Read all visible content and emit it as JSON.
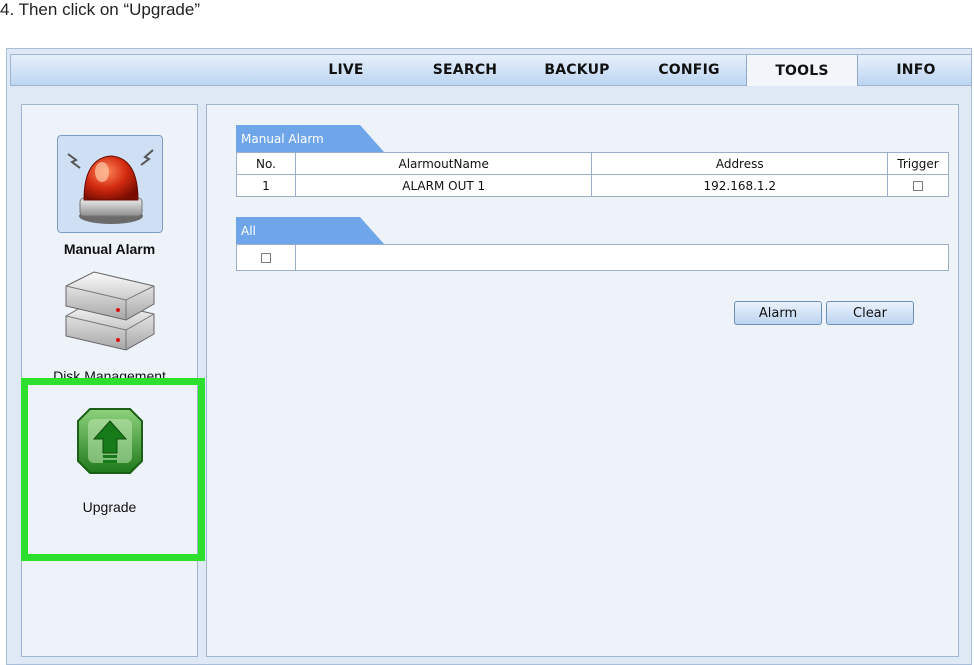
{
  "caption": "4. Then click on “Upgrade”",
  "nav": {
    "tabs": [
      "LIVE",
      "SEARCH",
      "BACKUP",
      "CONFIG",
      "TOOLS",
      "INFO"
    ],
    "active": "TOOLS"
  },
  "sidebar": {
    "items": [
      {
        "label": "Manual Alarm",
        "icon": "siren-icon"
      },
      {
        "label": "Disk Management",
        "icon": "hard-drive-stack-icon"
      },
      {
        "label": "Upgrade",
        "icon": "upgrade-arrow-icon"
      }
    ]
  },
  "manual_alarm": {
    "section_title": "Manual Alarm",
    "columns": [
      "No.",
      "AlarmoutName",
      "Address",
      "Trigger"
    ],
    "rows": [
      {
        "no": "1",
        "name": "ALARM OUT 1",
        "address": "192.168.1.2",
        "trigger": false
      }
    ]
  },
  "all_section": {
    "section_title": "All",
    "checked": false
  },
  "buttons": {
    "alarm": "Alarm",
    "clear": "Clear"
  },
  "colors": {
    "highlight": "#2ee02e",
    "section_tab": "#6fa6ea",
    "nav_gradient_top": "#e7f0fb",
    "nav_gradient_bottom": "#bcd5f1"
  }
}
